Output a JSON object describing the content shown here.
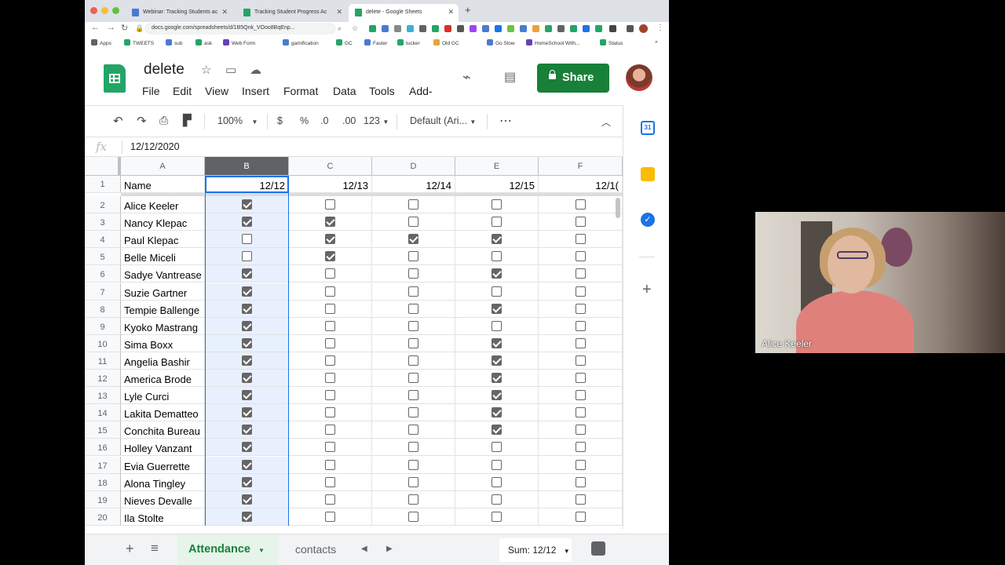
{
  "browser": {
    "tabs": [
      {
        "title": "Webinar: Tracking Students ac",
        "fav": "#4a7bd0"
      },
      {
        "title": "Tracking Student Progress Ac",
        "fav": "#23a566"
      },
      {
        "title": "delete - Google Sheets",
        "fav": "#23a566"
      }
    ],
    "url": "docs.google.com/spreadsheets/d/1B5Qnk_VOoo8BqEnp...",
    "bookmarks": [
      {
        "label": "Apps",
        "color": "#5f6368"
      },
      {
        "label": "TWEETS",
        "color": "#23a566"
      },
      {
        "label": "sub",
        "color": "#4a7bd0"
      },
      {
        "label": "ask",
        "color": "#23a566"
      },
      {
        "label": "Web Form",
        "color": "#6a3fb5"
      },
      {
        "label": "gamification",
        "color": "#4a7bd0"
      },
      {
        "label": "GC",
        "color": "#23a566"
      },
      {
        "label": "Faster",
        "color": "#4a7bd0"
      },
      {
        "label": "tucker",
        "color": "#23a566"
      },
      {
        "label": "Old GC",
        "color": "#e8a33a"
      },
      {
        "label": "Go Slow",
        "color": "#4a7bd0"
      },
      {
        "label": "HomeSchool With...",
        "color": "#6a3fb5"
      },
      {
        "label": "Status",
        "color": "#23a566"
      }
    ]
  },
  "doc": {
    "title": "delete",
    "menu": [
      "File",
      "Edit",
      "View",
      "Insert",
      "Format",
      "Data",
      "Tools",
      "Add-"
    ],
    "share_label": "Share"
  },
  "format_bar": {
    "zoom": "100%",
    "currency": "$",
    "percent": "%",
    "dec_less": ".0",
    "dec_more": ".00",
    "num_format": "123",
    "font": "Default (Ari...",
    "more": "⋯"
  },
  "formula_bar": {
    "fx": "fx",
    "value": "12/12/2020"
  },
  "columns": [
    "A",
    "B",
    "C",
    "D",
    "E",
    "F"
  ],
  "header_row": [
    "Name",
    "12/12",
    "12/13",
    "12/14",
    "12/15",
    "12/1("
  ],
  "rows": [
    {
      "n": "2",
      "name": "Alice Keeler",
      "checks": [
        true,
        false,
        false,
        false,
        false
      ]
    },
    {
      "n": "3",
      "name": "Nancy Klepac",
      "checks": [
        true,
        true,
        false,
        false,
        false
      ]
    },
    {
      "n": "4",
      "name": "Paul Klepac",
      "checks": [
        false,
        true,
        true,
        true,
        false
      ]
    },
    {
      "n": "5",
      "name": "Belle Miceli",
      "checks": [
        false,
        true,
        false,
        false,
        false
      ]
    },
    {
      "n": "6",
      "name": "Sadye Vantrease",
      "checks": [
        true,
        false,
        false,
        true,
        false
      ]
    },
    {
      "n": "7",
      "name": "Suzie Gartner",
      "checks": [
        true,
        false,
        false,
        false,
        false
      ]
    },
    {
      "n": "8",
      "name": "Tempie Ballenge",
      "checks": [
        true,
        false,
        false,
        true,
        false
      ]
    },
    {
      "n": "9",
      "name": "Kyoko Mastrang",
      "checks": [
        true,
        false,
        false,
        false,
        false
      ]
    },
    {
      "n": "10",
      "name": "Sima Boxx",
      "checks": [
        true,
        false,
        false,
        true,
        false
      ]
    },
    {
      "n": "11",
      "name": "Angelia Bashir",
      "checks": [
        true,
        false,
        false,
        true,
        false
      ]
    },
    {
      "n": "12",
      "name": "America Brode",
      "checks": [
        true,
        false,
        false,
        true,
        false
      ]
    },
    {
      "n": "13",
      "name": "Lyle Curci",
      "checks": [
        true,
        false,
        false,
        true,
        false
      ]
    },
    {
      "n": "14",
      "name": "Lakita Dematteo",
      "checks": [
        true,
        false,
        false,
        true,
        false
      ]
    },
    {
      "n": "15",
      "name": "Conchita Bureau",
      "checks": [
        true,
        false,
        false,
        true,
        false
      ]
    },
    {
      "n": "16",
      "name": "Holley Vanzant",
      "checks": [
        true,
        false,
        false,
        false,
        false
      ]
    },
    {
      "n": "17",
      "name": "Evia Guerrette",
      "checks": [
        true,
        false,
        false,
        false,
        false
      ]
    },
    {
      "n": "18",
      "name": "Alona Tingley",
      "checks": [
        true,
        false,
        false,
        false,
        false
      ]
    },
    {
      "n": "19",
      "name": "Nieves Devalle",
      "checks": [
        true,
        false,
        false,
        false,
        false
      ]
    },
    {
      "n": "20",
      "name": "Ila Stolte",
      "checks": [
        true,
        false,
        false,
        false,
        false
      ]
    }
  ],
  "sheets": {
    "add": "+",
    "list": "≡",
    "active": "Attendance",
    "other": "contacts",
    "sum": "Sum: 12/12"
  },
  "webcam": {
    "name": "Alice Keeler"
  },
  "colors": {
    "accent": "#1a73e8",
    "share": "#188038",
    "sheets_green": "#23a566"
  }
}
